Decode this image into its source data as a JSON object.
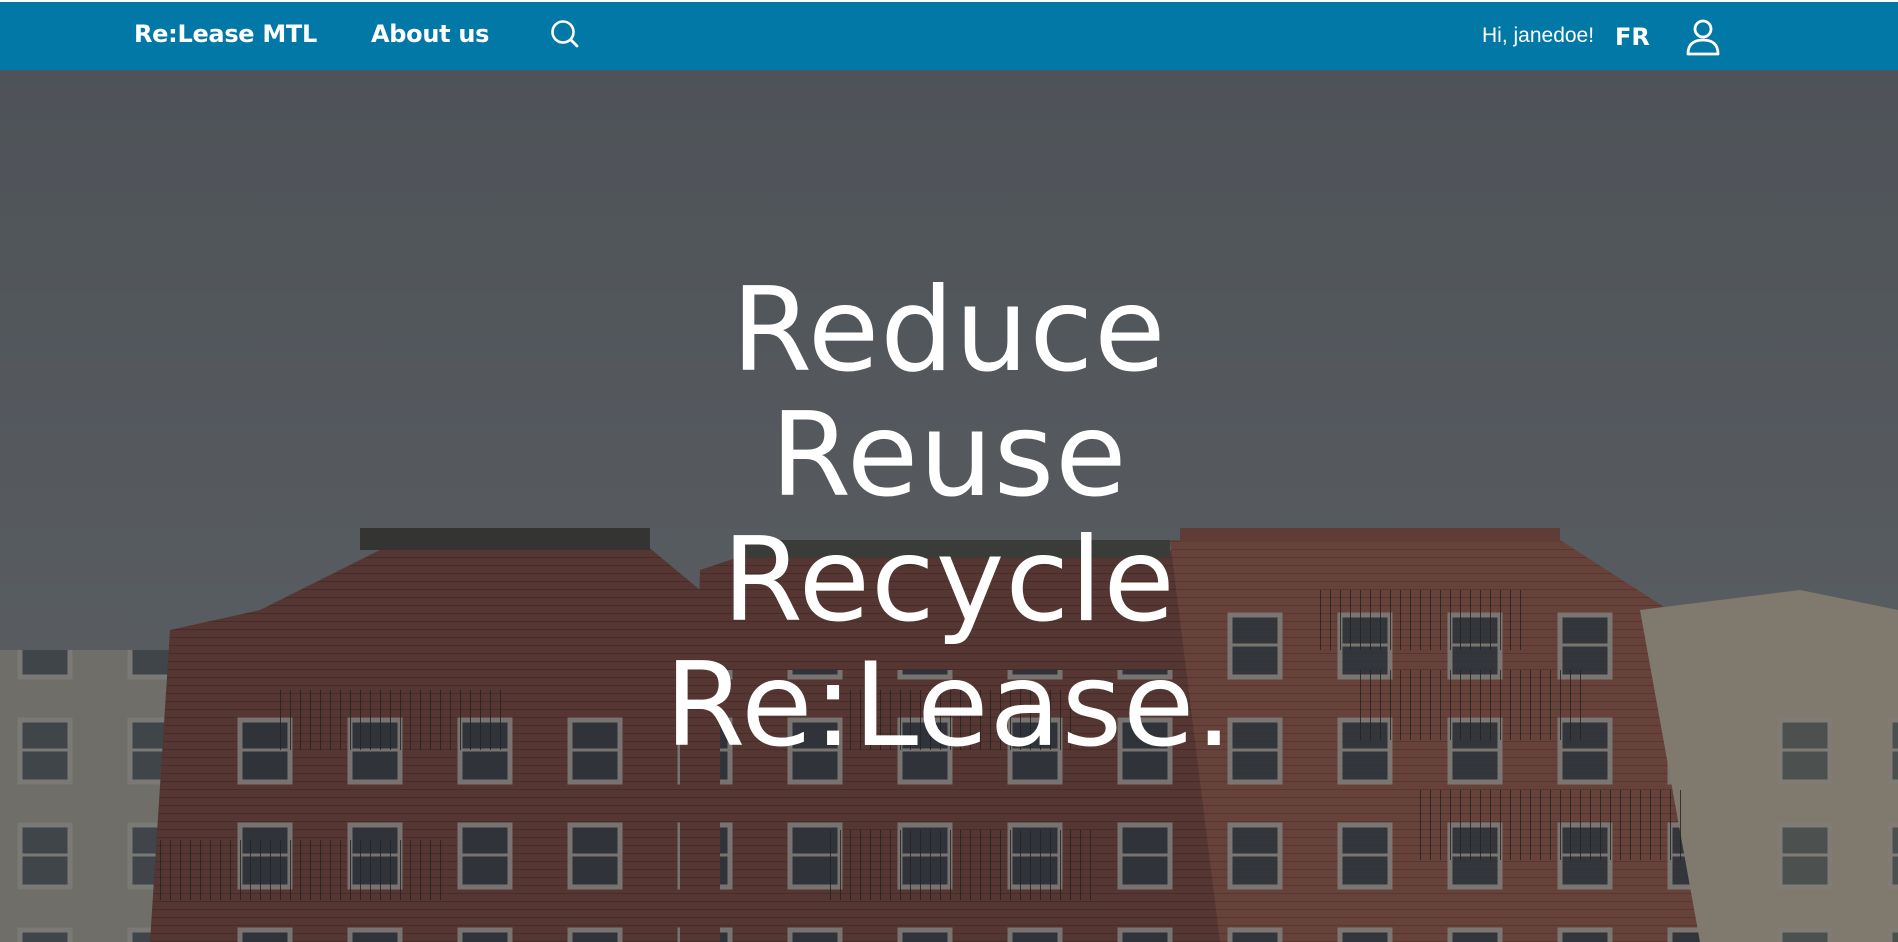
{
  "nav": {
    "brand": "Re:Lease MTL",
    "about": "About us",
    "search_icon": "search-icon",
    "greeting": "Hi, janedoe!",
    "language": "FR",
    "user_icon": "user-icon"
  },
  "hero": {
    "lines": [
      "Reduce",
      "Reuse",
      "Recycle",
      "Re:Lease."
    ],
    "background": "city-buildings-photo"
  },
  "colors": {
    "nav_bg": "#0278a6",
    "text": "#ffffff"
  }
}
